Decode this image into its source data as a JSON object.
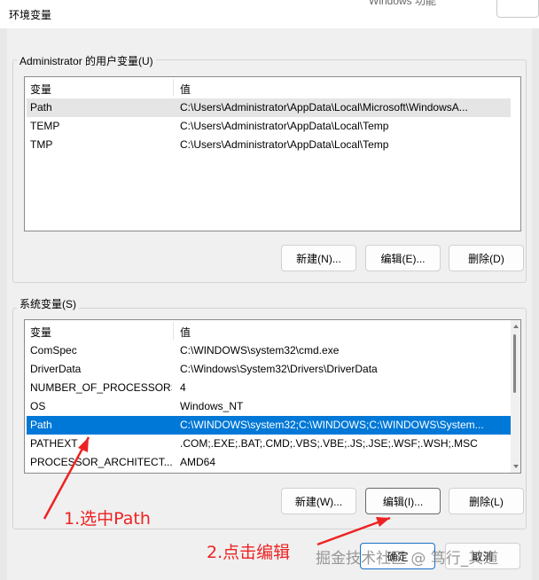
{
  "window": {
    "title": "环境变量",
    "background_window_text": "Windows 功能"
  },
  "user_vars": {
    "group_label": "Administrator 的用户变量(U)",
    "columns": [
      "变量",
      "值"
    ],
    "rows": [
      {
        "name": "Path",
        "value": "C:\\Users\\Administrator\\AppData\\Local\\Microsoft\\WindowsA..."
      },
      {
        "name": "TEMP",
        "value": "C:\\Users\\Administrator\\AppData\\Local\\Temp"
      },
      {
        "name": "TMP",
        "value": "C:\\Users\\Administrator\\AppData\\Local\\Temp"
      }
    ],
    "buttons": {
      "new": "新建(N)...",
      "edit": "编辑(E)...",
      "delete": "删除(D)"
    }
  },
  "system_vars": {
    "group_label": "系统变量(S)",
    "columns": [
      "变量",
      "值"
    ],
    "rows": [
      {
        "name": "ComSpec",
        "value": "C:\\WINDOWS\\system32\\cmd.exe"
      },
      {
        "name": "DriverData",
        "value": "C:\\Windows\\System32\\Drivers\\DriverData"
      },
      {
        "name": "NUMBER_OF_PROCESSORS",
        "value": "4"
      },
      {
        "name": "OS",
        "value": "Windows_NT"
      },
      {
        "name": "Path",
        "value": "C:\\WINDOWS\\system32;C:\\WINDOWS;C:\\WINDOWS\\System..."
      },
      {
        "name": "PATHEXT",
        "value": ".COM;.EXE;.BAT;.CMD;.VBS;.VBE;.JS;.JSE;.WSF;.WSH;.MSC"
      },
      {
        "name": "PROCESSOR_ARCHITECT...",
        "value": "AMD64"
      }
    ],
    "buttons": {
      "new": "新建(W)...",
      "edit": "编辑(I)...",
      "delete": "删除(L)"
    }
  },
  "footer": {
    "ok": "确定",
    "cancel": "取消"
  },
  "annotations": {
    "step1": "1.选中Path",
    "step2": "2.点击编辑"
  },
  "watermark": "掘金技术社区 @ 笃行_其道",
  "colors": {
    "selection": "#0078d7",
    "annotation": "#ee2222"
  }
}
